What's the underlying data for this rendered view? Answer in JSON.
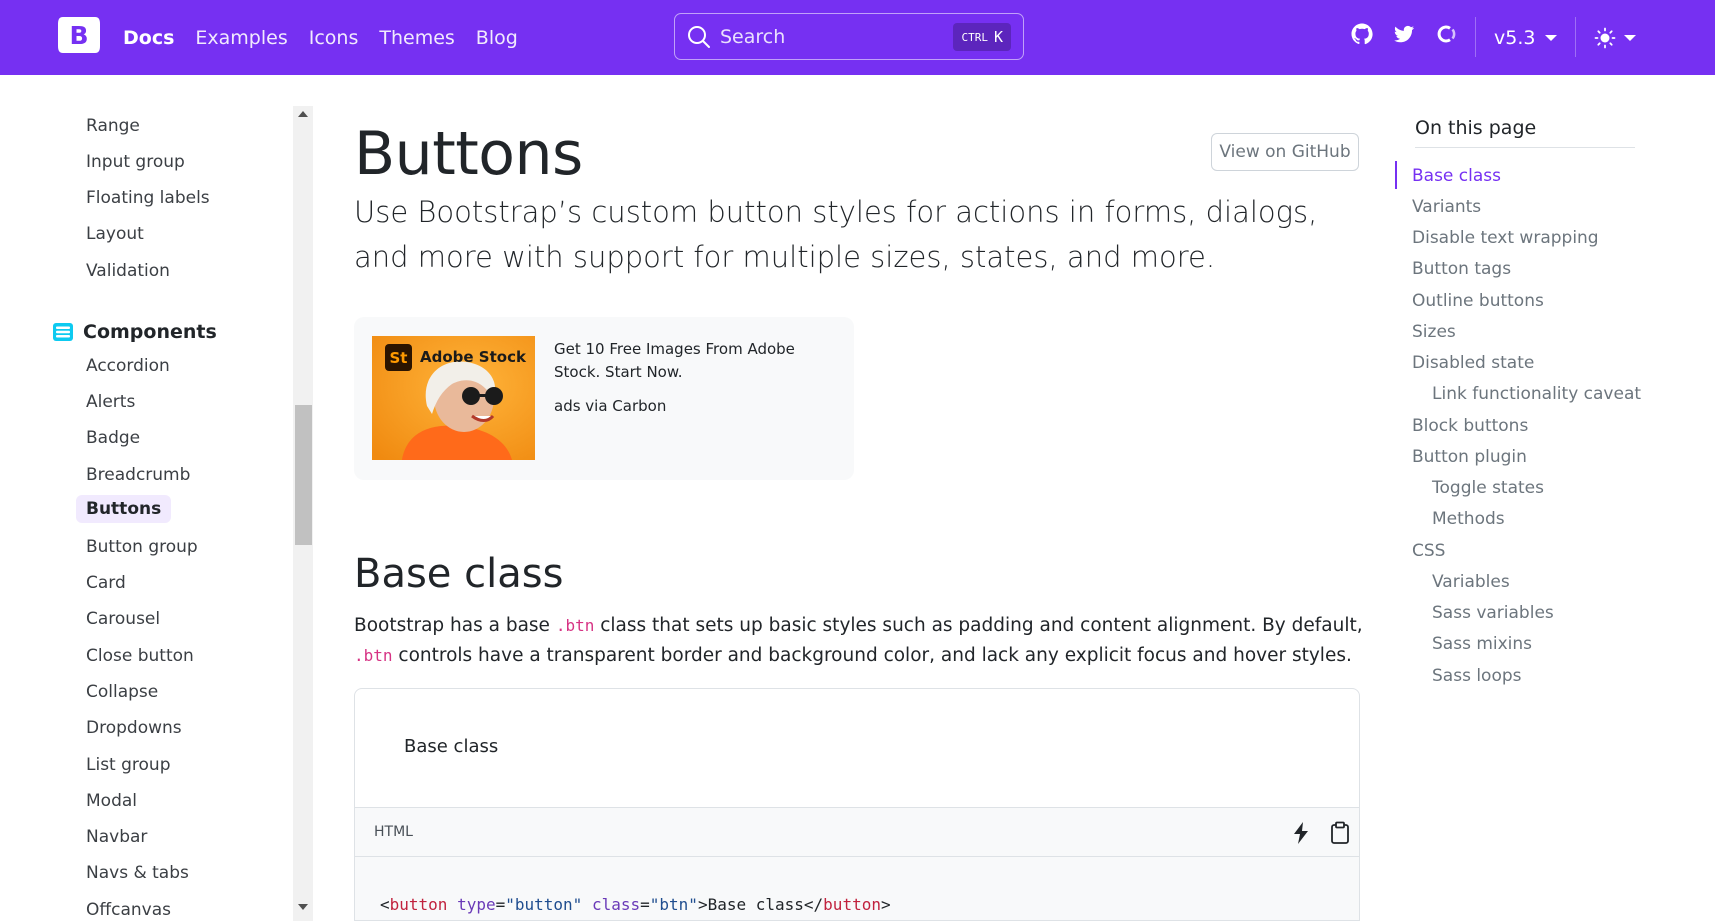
{
  "header": {
    "brand_letter": "B",
    "nav": [
      "Docs",
      "Examples",
      "Icons",
      "Themes",
      "Blog"
    ],
    "search_placeholder": "Search",
    "search_shortcut_mod": "CTRL",
    "search_shortcut_key": "K",
    "version": "v5.3",
    "icons": [
      "github-icon",
      "twitter-icon",
      "opencollective-icon",
      "theme-sun-icon"
    ],
    "accent_color": "#7630f2"
  },
  "sidebar": {
    "top_items": [
      "Range",
      "Input group",
      "Floating labels",
      "Layout",
      "Validation"
    ],
    "section_title": "Components",
    "section_items": [
      "Accordion",
      "Alerts",
      "Badge",
      "Breadcrumb",
      "Buttons",
      "Button group",
      "Card",
      "Carousel",
      "Close button",
      "Collapse",
      "Dropdowns",
      "List group",
      "Modal",
      "Navbar",
      "Navs & tabs",
      "Offcanvas"
    ],
    "active_item": "Buttons"
  },
  "main": {
    "title": "Buttons",
    "github_link": "View on GitHub",
    "lead": "Use Bootstrap’s custom button styles for actions in forms, dialogs, and more with support for multiple sizes, states, and more.",
    "ad": {
      "brand_badge": "St",
      "brand_name": "Adobe Stock",
      "text": "Get 10 Free Images From Adobe Stock. Start Now.",
      "via": "ads via Carbon"
    },
    "section_heading": "Base class",
    "body_part1": "Bootstrap has a base ",
    "body_code1": ".btn",
    "body_part2": " class that sets up basic styles such as padding and content alignment. By default, ",
    "body_code2": ".btn",
    "body_part3": " controls have a transparent border and background color, and lack any explicit focus and hover styles.",
    "example": {
      "button_label": "Base class",
      "lang_label": "HTML",
      "code": {
        "open_bracket": "<",
        "tag": "button",
        "attr1": "type",
        "eq": "=",
        "val1": "\"button\"",
        "attr2": "class",
        "val2": "\"btn\"",
        "gt": ">",
        "content": "Base class",
        "close_open": "</",
        "close_tag": "button",
        "close_gt": ">"
      }
    }
  },
  "toc": {
    "title": "On this page",
    "items": [
      {
        "label": "Base class",
        "level": 1,
        "active": true
      },
      {
        "label": "Variants",
        "level": 1
      },
      {
        "label": "Disable text wrapping",
        "level": 1
      },
      {
        "label": "Button tags",
        "level": 1
      },
      {
        "label": "Outline buttons",
        "level": 1
      },
      {
        "label": "Sizes",
        "level": 1
      },
      {
        "label": "Disabled state",
        "level": 1
      },
      {
        "label": "Link functionality caveat",
        "level": 2
      },
      {
        "label": "Block buttons",
        "level": 1
      },
      {
        "label": "Button plugin",
        "level": 1
      },
      {
        "label": "Toggle states",
        "level": 2
      },
      {
        "label": "Methods",
        "level": 2
      },
      {
        "label": "CSS",
        "level": 1
      },
      {
        "label": "Variables",
        "level": 2
      },
      {
        "label": "Sass variables",
        "level": 2
      },
      {
        "label": "Sass mixins",
        "level": 2
      },
      {
        "label": "Sass loops",
        "level": 2
      }
    ]
  }
}
